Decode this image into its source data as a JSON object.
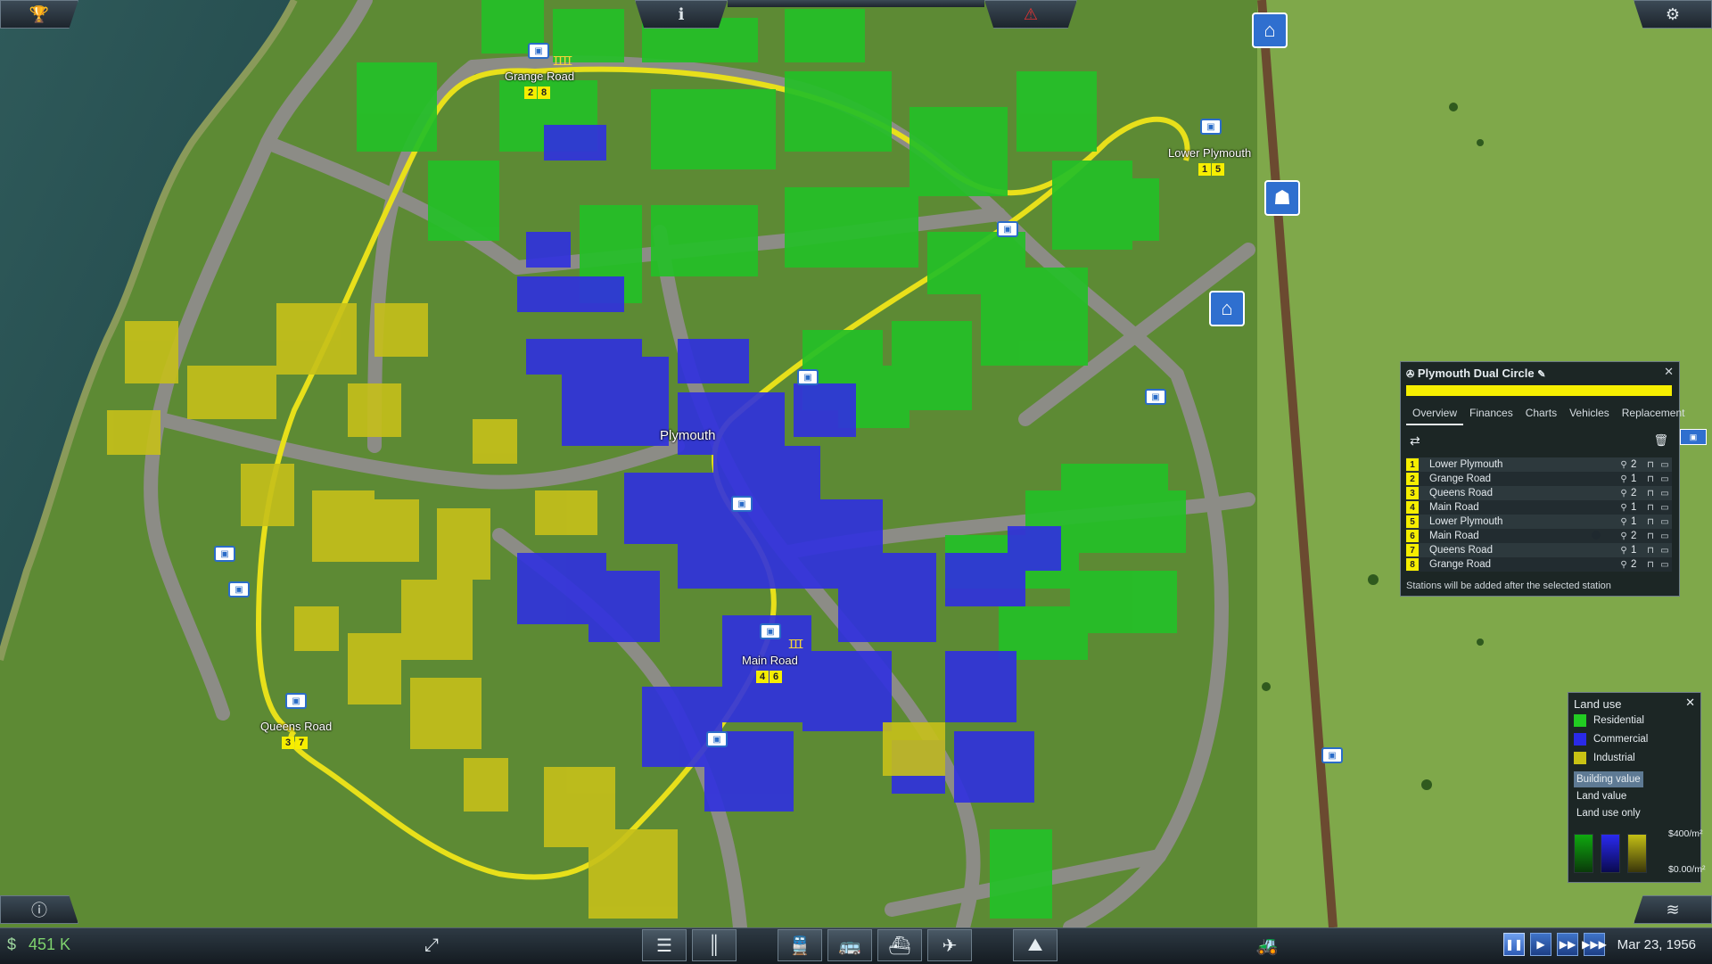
{
  "top": {
    "trophy_icon": "trophy-icon",
    "info_icon": "info-icon",
    "warning_icon": "warning-icon",
    "settings_icon": "gear-icon"
  },
  "bottom": {
    "currency_symbol": "$",
    "money": "451 K",
    "date": "Mar 23, 1956",
    "tools": [
      "rotate-icon",
      "rail-track-icon",
      "road-icon",
      "train-icon",
      "bus-icon",
      "ship-icon",
      "airplane-icon",
      "terrain-icon",
      "bulldozer-icon"
    ],
    "speed": [
      "pause",
      "play",
      "fast",
      "fastest"
    ],
    "active_speed": "pause"
  },
  "map": {
    "town_name": "Plymouth",
    "stations": [
      {
        "name": "Grange Road",
        "lines": [
          "2",
          "8"
        ]
      },
      {
        "name": "Lower Plymouth",
        "lines": [
          "1",
          "5"
        ]
      },
      {
        "name": "Main Road",
        "lines": [
          "4",
          "6"
        ]
      },
      {
        "name": "Queens Road",
        "lines": [
          "3",
          "7"
        ]
      }
    ]
  },
  "line_window": {
    "title": "Plymouth Dual Circle",
    "color": "#f6ee00",
    "tabs": [
      "Overview",
      "Finances",
      "Charts",
      "Vehicles",
      "Replacement"
    ],
    "active_tab": "Overview",
    "stations": [
      {
        "num": "1",
        "name": "Lower Plymouth",
        "count": "2"
      },
      {
        "num": "2",
        "name": "Grange Road",
        "count": "1"
      },
      {
        "num": "3",
        "name": "Queens Road",
        "count": "2"
      },
      {
        "num": "4",
        "name": "Main Road",
        "count": "1"
      },
      {
        "num": "5",
        "name": "Lower Plymouth",
        "count": "1"
      },
      {
        "num": "6",
        "name": "Main Road",
        "count": "2"
      },
      {
        "num": "7",
        "name": "Queens Road",
        "count": "1"
      },
      {
        "num": "8",
        "name": "Grange Road",
        "count": "2"
      }
    ],
    "note": "Stations will be added after the selected station",
    "close": "✕"
  },
  "land_use": {
    "title": "Land use",
    "close": "✕",
    "legend": [
      {
        "label": "Residential",
        "color": "#22cc22"
      },
      {
        "label": "Commercial",
        "color": "#2a2ae8"
      },
      {
        "label": "Industrial",
        "color": "#c9c214"
      }
    ],
    "modes": [
      "Building value",
      "Land value",
      "Land use only"
    ],
    "selected_mode": "Building value",
    "max_label": "$400/m²",
    "min_label": "$0.00/m²"
  }
}
